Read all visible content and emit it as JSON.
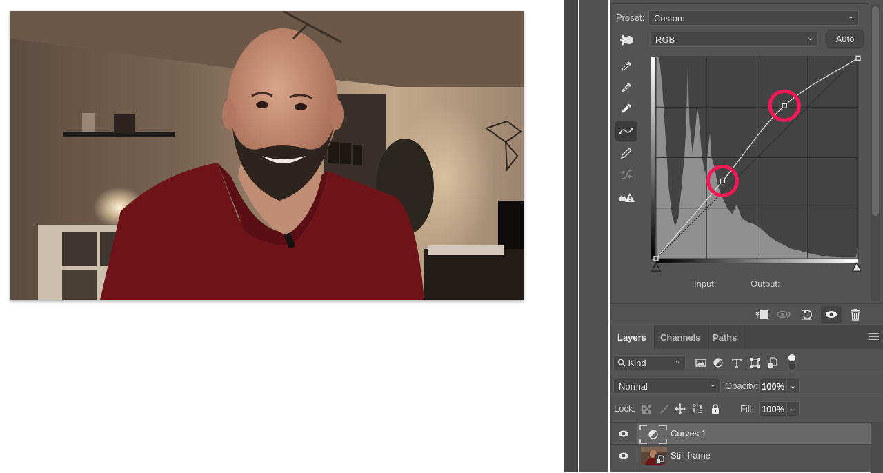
{
  "photo": {
    "description": "Still frame of a smiling bald bearded man in a dark red v-neck shirt with a lavalier microphone, in a warmly lit living room"
  },
  "properties": {
    "preset_label": "Preset:",
    "preset_value": "Custom",
    "channel_value": "RGB",
    "auto_label": "Auto",
    "input_label": "Input:",
    "output_label": "Output:",
    "tools": [
      {
        "name": "sample-black-point-icon"
      },
      {
        "name": "sample-gray-point-icon"
      },
      {
        "name": "sample-white-point-icon"
      },
      {
        "name": "edit-points-curve-icon",
        "active": true
      },
      {
        "name": "draw-pencil-icon"
      },
      {
        "name": "smooth-curve-icon",
        "disabled": true
      },
      {
        "name": "clipping-warning-icon"
      }
    ],
    "curve": {
      "channel": "RGB",
      "range": [
        0,
        255
      ],
      "points": [
        [
          0,
          0
        ],
        [
          84,
          98
        ],
        [
          162,
          193
        ],
        [
          255,
          253
        ]
      ],
      "highlighted_points": [
        1,
        2
      ],
      "highlight_color": "#ff1654",
      "grid_divisions": 4
    },
    "footer_buttons": [
      {
        "name": "clip-to-layer-icon"
      },
      {
        "name": "view-previous-state-icon",
        "disabled": true
      },
      {
        "name": "reset-icon"
      },
      {
        "name": "toggle-visibility-icon",
        "active": true
      },
      {
        "name": "delete-icon"
      }
    ]
  },
  "layers_panel": {
    "tabs": [
      {
        "label": "Layers",
        "active": true
      },
      {
        "label": "Channels",
        "active": false
      },
      {
        "label": "Paths",
        "active": false
      }
    ],
    "filter_kind": "Kind",
    "blend_mode": "Normal",
    "opacity_label": "Opacity:",
    "opacity_value": "100%",
    "lock_label": "Lock:",
    "fill_label": "Fill:",
    "fill_value": "100%",
    "layers": [
      {
        "name": "Curves 1",
        "type": "adjustment",
        "visible": true,
        "selected": true
      },
      {
        "name": "Still frame",
        "type": "smart-object",
        "visible": true,
        "selected": false
      }
    ]
  }
}
